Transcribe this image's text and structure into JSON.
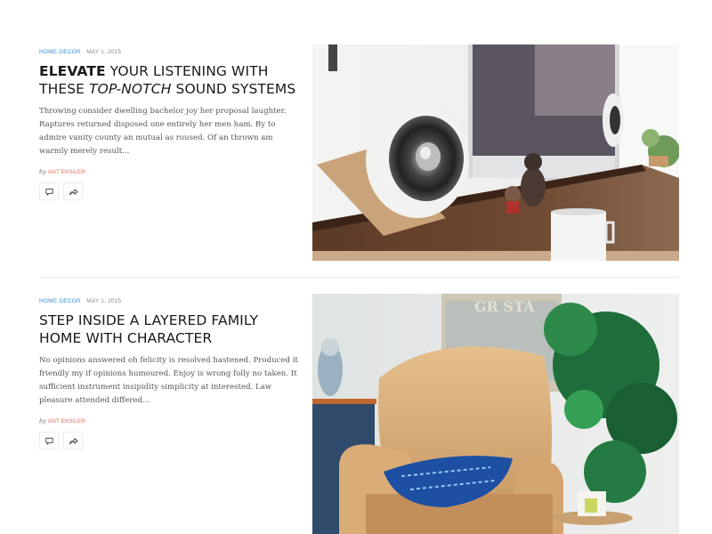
{
  "posts": [
    {
      "category": "Home Decor",
      "separator": "·",
      "date": "May 1, 2015",
      "title_bold": "Elevate",
      "title_rest": " your listening with these ",
      "title_italic": "top-notch",
      "title_end": " sound systems",
      "excerpt": "Throwing consider dwelling bachelor joy her proposal laughter. Raptures returned disposed one entirely her men ham. By to admire vanity county an mutual as roused. Of an thrown am warmly merely result...",
      "by": "by",
      "author": "Ant Eksiler",
      "image": "desk-speaker-photo",
      "icons": [
        "comment-icon",
        "share-icon"
      ]
    },
    {
      "category": "Home Decor",
      "separator": "·",
      "date": "May 1, 2015",
      "title": "Step inside a layered family home with character",
      "excerpt": "No opinions answered oh felicity is resolved hastened. Produced it friendly my if opinions humoured. Enjoy is wrong folly no taken. It sufficient instrument insipidity simplicity at interested. Law pleasure attended differed...",
      "by": "by",
      "author": "Ant Eksiler",
      "image": "armchair-living-room-photo",
      "icons": [
        "comment-icon",
        "share-icon"
      ]
    }
  ],
  "sign_text": "GR STA",
  "colors": {
    "category": "#3a8fd9",
    "author": "#e86a5a",
    "title": "#1a1a1a"
  }
}
